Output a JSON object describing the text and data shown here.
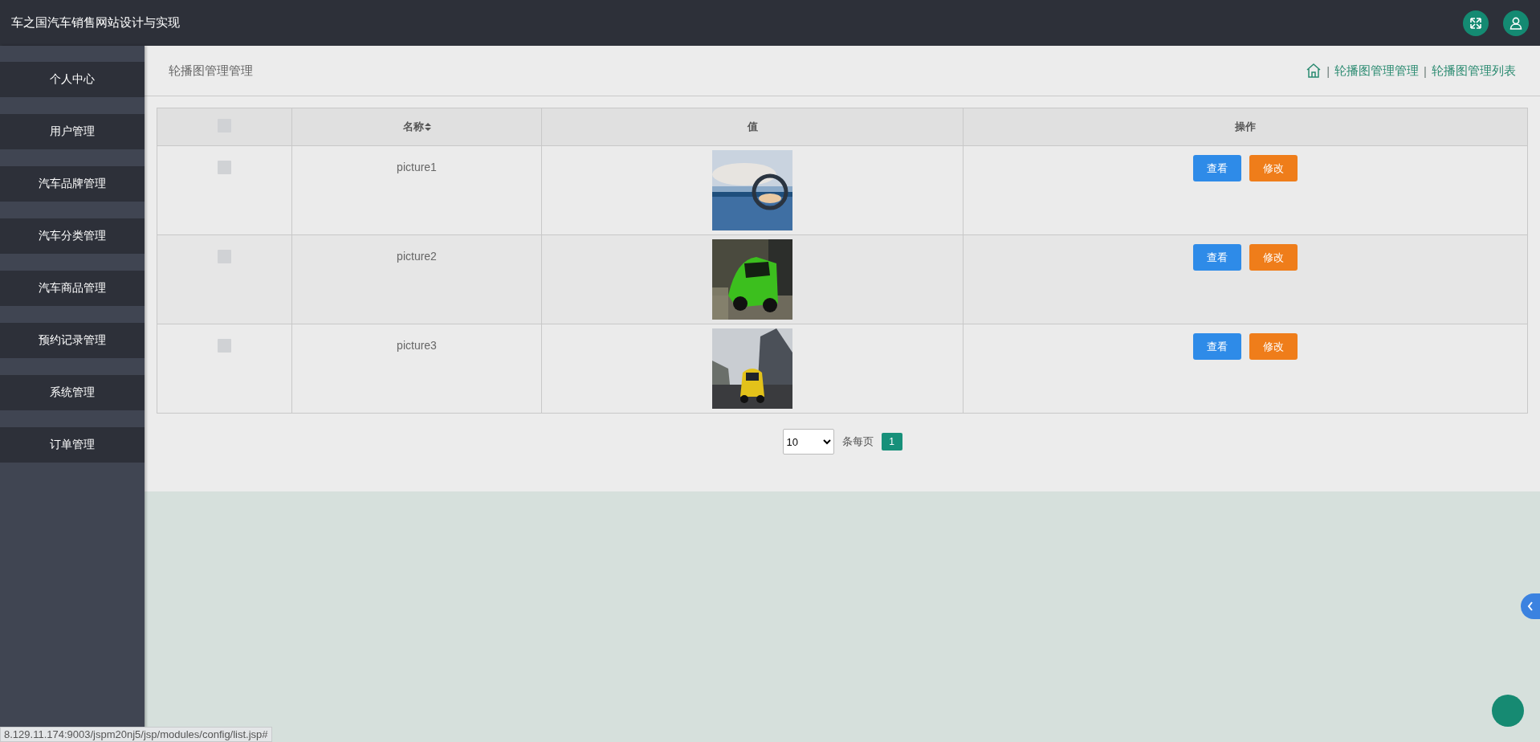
{
  "header": {
    "title": "车之国汽车销售网站设计与实现"
  },
  "sidebar": {
    "items": [
      {
        "label": "个人中心"
      },
      {
        "label": "用户管理"
      },
      {
        "label": "汽车品牌管理"
      },
      {
        "label": "汽车分类管理"
      },
      {
        "label": "汽车商品管理"
      },
      {
        "label": "预约记录管理"
      },
      {
        "label": "系统管理"
      },
      {
        "label": "订单管理"
      }
    ]
  },
  "page_header": {
    "title": "轮播图管理管理",
    "breadcrumb": [
      {
        "kind": "separator",
        "text": "|"
      },
      {
        "kind": "link",
        "text": "轮播图管理管理"
      },
      {
        "kind": "separator",
        "text": "|"
      },
      {
        "kind": "link",
        "text": "轮播图管理列表"
      }
    ]
  },
  "table": {
    "columns": [
      {
        "kind": "checkbox",
        "checked": false
      },
      {
        "kind": "text",
        "label": "名称",
        "sortable": true
      },
      {
        "kind": "text",
        "label": "值",
        "sortable": false
      },
      {
        "kind": "text",
        "label": "操作",
        "sortable": false
      }
    ],
    "rows": [
      {
        "checked": false,
        "name": "picture1",
        "value": {
          "kind": "picture"
        },
        "actions": [
          {
            "kind": "view",
            "label": "查看"
          },
          {
            "kind": "edit",
            "label": "修改"
          }
        ]
      },
      {
        "checked": false,
        "name": "picture2",
        "value": {
          "kind": "picture"
        },
        "actions": [
          {
            "kind": "view",
            "label": "查看"
          },
          {
            "kind": "edit",
            "label": "修改"
          }
        ]
      },
      {
        "checked": false,
        "name": "picture3",
        "value": {
          "kind": "picture"
        },
        "actions": [
          {
            "kind": "view",
            "label": "查看"
          },
          {
            "kind": "edit",
            "label": "修改"
          }
        ]
      }
    ]
  },
  "pagination": {
    "page_size": "10",
    "page_size_label": "条每页",
    "pages": [
      {
        "label": "1",
        "selected": true
      }
    ]
  },
  "status_bar": {
    "url": "8.129.11.174:9003/jspm20nj5/jsp/modules/config/list.jsp#"
  }
}
